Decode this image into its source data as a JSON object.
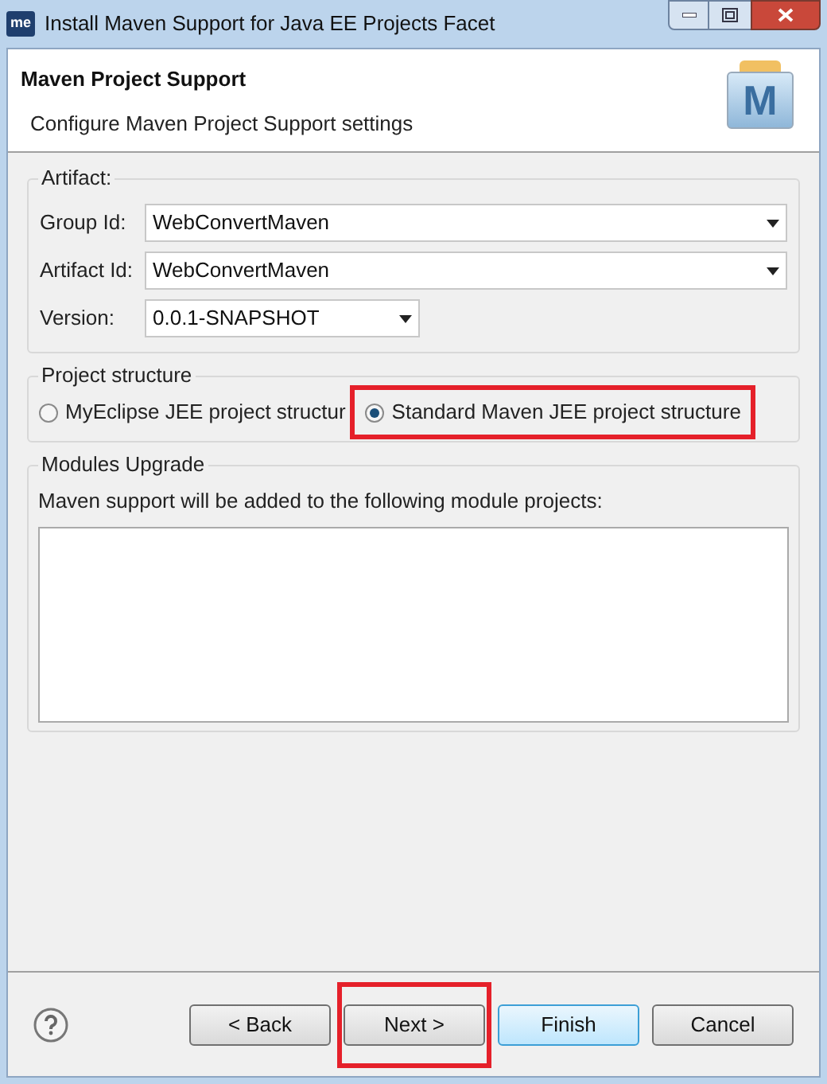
{
  "window": {
    "title": "Install Maven Support for Java EE Projects Facet",
    "app_badge": "me"
  },
  "header": {
    "title": "Maven Project Support",
    "subtitle": "Configure Maven Project Support settings",
    "logo_letter": "M"
  },
  "artifact": {
    "legend": "Artifact:",
    "fields": [
      {
        "label": "Group Id:",
        "value": "WebConvertMaven",
        "wide": true
      },
      {
        "label": "Artifact Id:",
        "value": "WebConvertMaven",
        "wide": true
      },
      {
        "label": "Version:",
        "value": "0.0.1-SNAPSHOT",
        "wide": false
      }
    ]
  },
  "project_structure": {
    "legend": "Project structure",
    "options": [
      {
        "label": "MyEclipse JEE project structur",
        "selected": false,
        "highlighted": false
      },
      {
        "label": "Standard Maven JEE project structure",
        "selected": true,
        "highlighted": true
      }
    ]
  },
  "modules_upgrade": {
    "legend": "Modules Upgrade",
    "message": "Maven support will be added to the following module projects:"
  },
  "buttons": [
    {
      "label": "< Back",
      "default": false,
      "highlighted": false
    },
    {
      "label": "Next >",
      "default": false,
      "highlighted": true
    },
    {
      "label": "Finish",
      "default": true,
      "highlighted": false
    },
    {
      "label": "Cancel",
      "default": false,
      "highlighted": false
    }
  ]
}
